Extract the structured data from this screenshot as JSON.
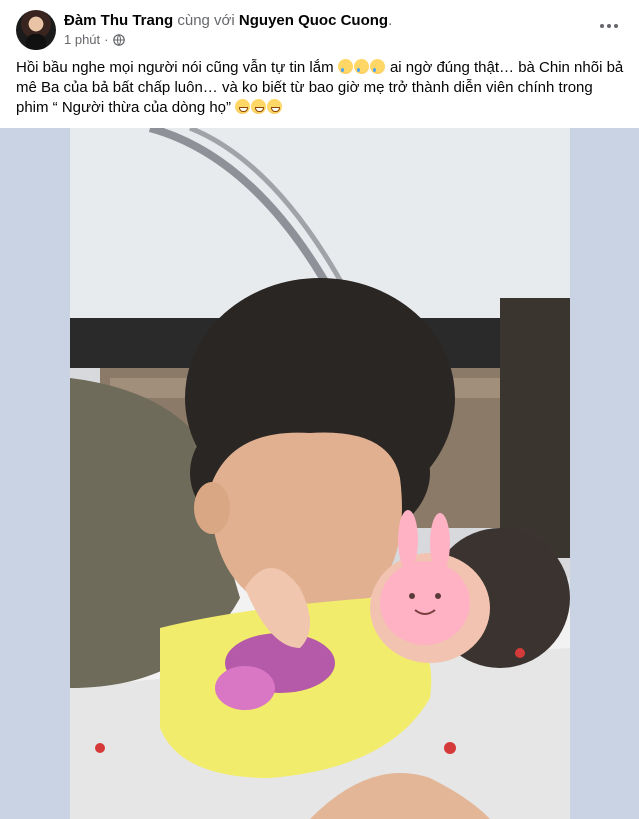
{
  "post": {
    "author": "Đàm Thu Trang",
    "with_text": "cùng với",
    "tagged": "Nguyen Quoc Cuong",
    "tagged_suffix": ".",
    "time": "1 phút",
    "separator": "·",
    "privacy_icon": "globe-icon",
    "more_icon": "more-options-icon",
    "text_part1": "Hồi bầu nghe mọi người nói cũng vẫn tự tin lắm",
    "text_part2": "ai ngờ đúng thật… bà Chin nhõi bả mê Ba của bả bất chấp luôn… và ko biết từ bao giờ mẹ trở thành diễn viên chính trong phim “ Người thừa của dòng họ”",
    "emoji_1": "crying-face-emoji",
    "emoji_2": "grinning-face-emoji"
  },
  "colors": {
    "text_primary": "#050505",
    "text_secondary": "#65676b",
    "media_background": "#c9d3e3"
  }
}
